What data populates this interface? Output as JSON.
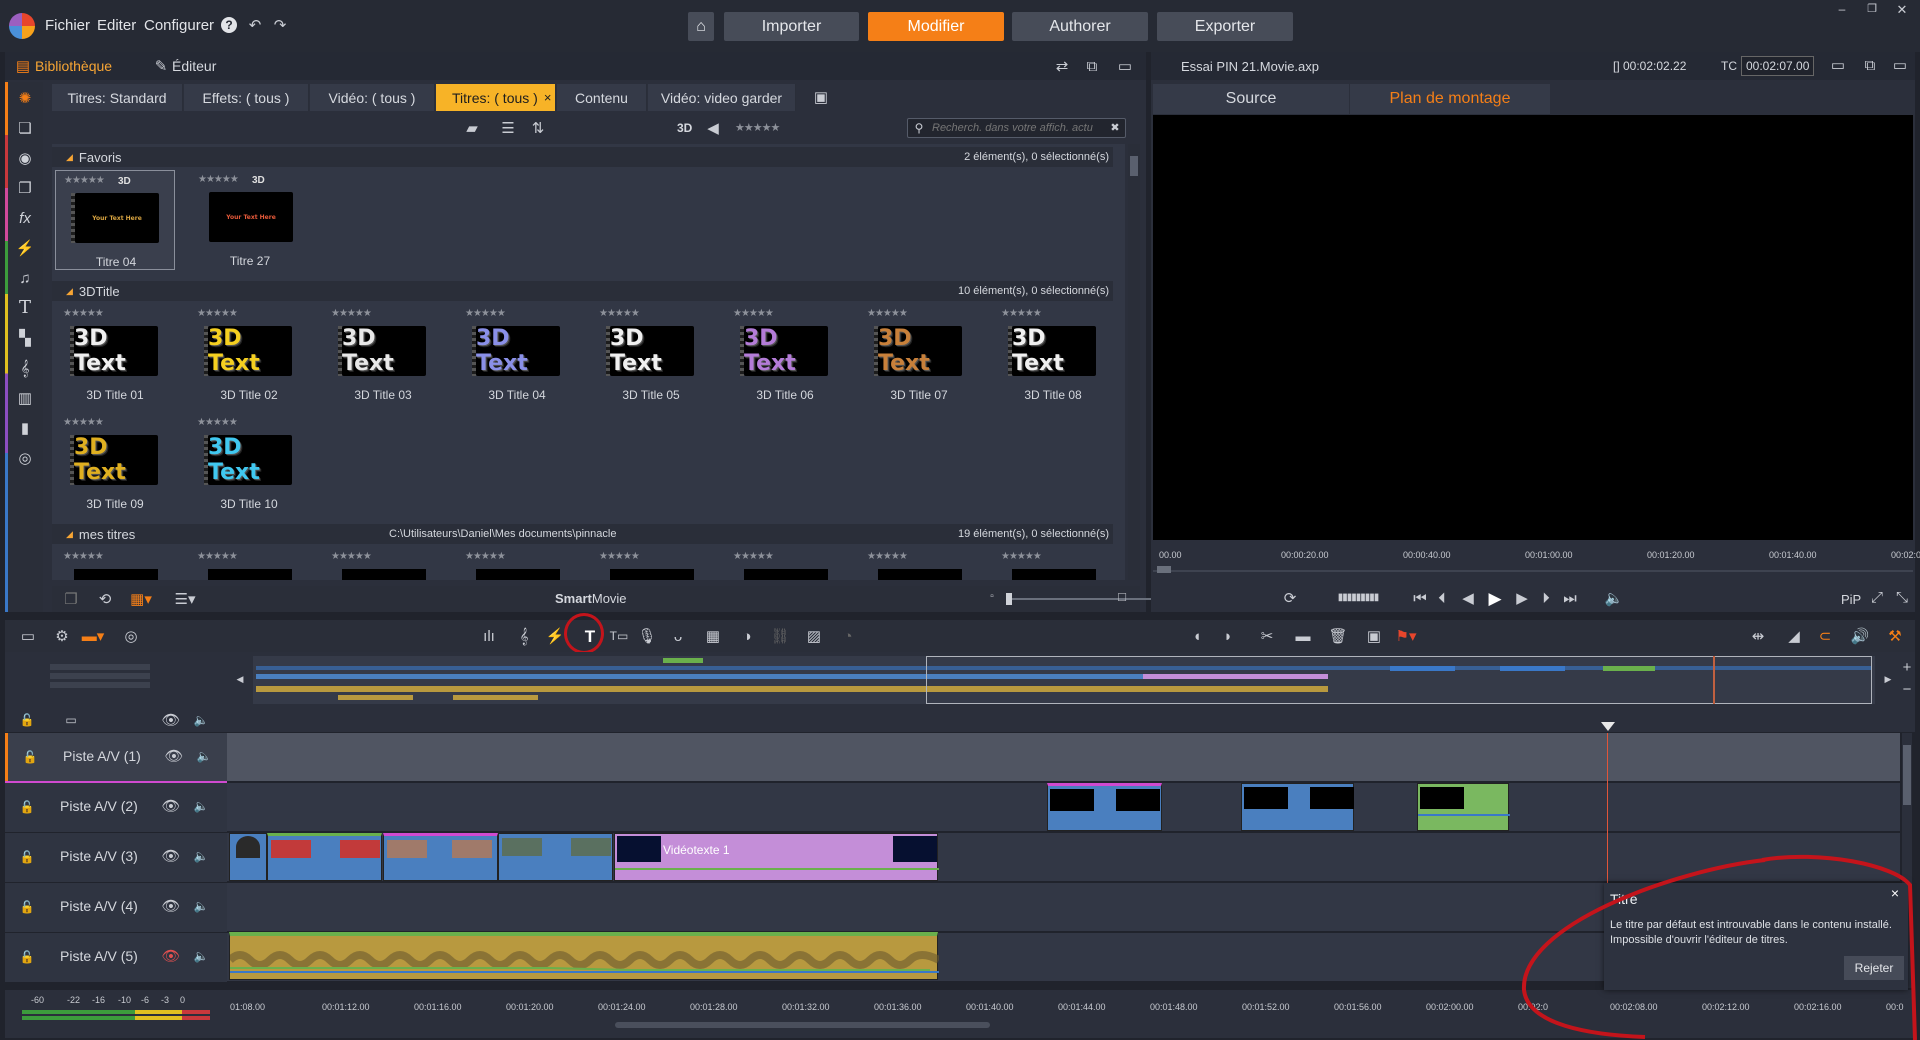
{
  "menu": {
    "items": [
      "Fichier",
      "Editer",
      "Configurer"
    ],
    "help": "?"
  },
  "nav": {
    "buttons": [
      "Importer",
      "Modifier",
      "Authorer",
      "Exporter"
    ],
    "active": "Modifier"
  },
  "library": {
    "tab_bibliotheque": "Bibliothèque",
    "tab_editeur": "Éditeur",
    "tabs": [
      {
        "label": "Titres: Standard"
      },
      {
        "label": "Effets: ( tous )"
      },
      {
        "label": "Vidéo: ( tous )"
      },
      {
        "label": "Titres: ( tous )",
        "active": true
      },
      {
        "label": "Contenu"
      },
      {
        "label": "Vidéo: video garder"
      }
    ],
    "close_glyph": "×",
    "toolbar_3d": "3D",
    "search_placeholder": "Recherch. dans votre affich. actu",
    "groups": [
      {
        "title": "Favoris",
        "count": "2 élément(s), 0 sélectionné(s)"
      },
      {
        "title": "3DTitle",
        "count": "10 élément(s), 0 sélectionné(s)"
      },
      {
        "title": "mes titres",
        "path": "C:\\Utilisateurs\\Daniel\\Mes documents\\pinnacle",
        "count": "19 élément(s), 0 sélectionné(s)"
      }
    ],
    "favorites": [
      {
        "label": "Titre 04",
        "thumb_text": "Your Text Here",
        "badge": "3D",
        "color": "#d8a441"
      },
      {
        "label": "Titre 27",
        "thumb_text": "Your Text Here",
        "badge": "3D",
        "color": "#e85a3a"
      }
    ],
    "titles3d": [
      {
        "label": "3D Title 01",
        "thumb_text": "3D Text",
        "color": "#f0f0f0"
      },
      {
        "label": "3D Title 02",
        "thumb_text": "3D Text",
        "color": "#f5d020"
      },
      {
        "label": "3D Title 03",
        "thumb_text": "3D Text",
        "color": "#e8e8e8"
      },
      {
        "label": "3D Title 04",
        "thumb_text": "3D Text",
        "color": "#8a90e8"
      },
      {
        "label": "3D Title 05",
        "thumb_text": "3D Text",
        "color": "#f0f0f0"
      },
      {
        "label": "3D Title 06",
        "thumb_text": "3D Text",
        "color": "#b47cd8"
      },
      {
        "label": "3D Title 07",
        "thumb_text": "3D Text",
        "color": "#c8803a"
      },
      {
        "label": "3D Title 08",
        "thumb_text": "3D Text",
        "color": "#f0f0f0"
      },
      {
        "label": "3D Title 09",
        "thumb_text": "3D Text",
        "color": "#e0b020"
      },
      {
        "label": "3D Title 10",
        "thumb_text": "3D Text",
        "color": "#40c8f0"
      }
    ],
    "footer_label_bold": "Smart",
    "footer_label": "Movie",
    "stars": "★★★★★"
  },
  "preview": {
    "project": "Essai PIN 21.Movie.axp",
    "duration": "[] 00:02:02.22",
    "tc_label": "TC",
    "timecode": "00:02:07.00",
    "tabs": [
      "Source",
      "Plan de montage"
    ],
    "active_tab": "Plan de montage",
    "ruler": [
      "00.00",
      "00:00:20.00",
      "00:00:40.00",
      "00:01:00.00",
      "00:01:20.00",
      "00:01:40.00",
      "00:02:00.0"
    ],
    "pip": "PiP"
  },
  "timeline": {
    "tracks": [
      "Piste A/V (1)",
      "Piste A/V (2)",
      "Piste A/V (3)",
      "Piste A/V (4)",
      "Piste A/V (5)"
    ],
    "clip_label": "Vidéotexte 1",
    "ruler": [
      "01:08.00",
      "00:01:12.00",
      "00:01:16.00",
      "00:01:20.00",
      "00:01:24.00",
      "00:01:28.00",
      "00:01:32.00",
      "00:01:36.00",
      "00:01:40.00",
      "00:01:44.00",
      "00:01:48.00",
      "00:01:52.00",
      "00:01:56.00",
      "00:02:00.00",
      "00:02:0",
      "00:02:08.00",
      "00:02:12.00",
      "00:02:16.00",
      "00:0"
    ],
    "meter": [
      "-60",
      "-22",
      "-16",
      "-10",
      "-6",
      "-3",
      "0"
    ]
  },
  "notification": {
    "title": "Titre",
    "message": "Le titre par défaut est introuvable dans le contenu installé. Impossible d'ouvrir l'éditeur de titres.",
    "button": "Rejeter",
    "close": "×"
  },
  "colors": {
    "accent": "#f57f17",
    "tab_active": "#f7b327",
    "annotation": "#c4141b"
  }
}
